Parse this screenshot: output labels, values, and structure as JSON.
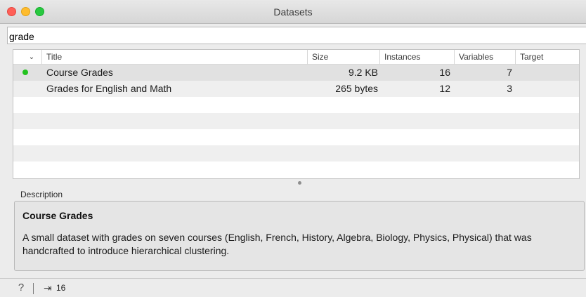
{
  "window": {
    "title": "Datasets"
  },
  "filter": {
    "value": "grade"
  },
  "table": {
    "columns": [
      "",
      "Title",
      "Size",
      "Instances",
      "Variables",
      "Target"
    ],
    "rows": [
      {
        "title": "Course Grades",
        "size": "9.2 KB",
        "instances": "16",
        "variables": "7",
        "target": "",
        "status": "green-dot"
      },
      {
        "title": "Grades for English and Math",
        "size": "265 bytes",
        "instances": "12",
        "variables": "3",
        "target": ""
      }
    ]
  },
  "description": {
    "label": "Description",
    "title": "Course Grades",
    "text": "A small dataset with grades on seven courses (English, French, History, Algebra, Biology, Physics, Physical) that was handcrafted to introduce hierarchical clustering."
  },
  "statusbar": {
    "help_icon": "question-icon",
    "output_icon": "output-icon",
    "output_count": "16"
  },
  "colors": {
    "status_dot": "#23c21f",
    "selected_row": "#e1e1e1",
    "stripe_row": "#efefef"
  }
}
